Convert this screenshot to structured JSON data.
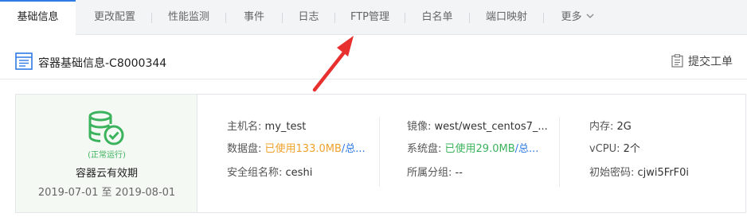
{
  "tabs": [
    {
      "label": "基础信息",
      "active": true
    },
    {
      "label": "更改配置"
    },
    {
      "label": "性能监测"
    },
    {
      "label": "事件"
    },
    {
      "label": "日志"
    },
    {
      "label": "FTP管理"
    },
    {
      "label": "白名单"
    },
    {
      "label": "端口映射"
    },
    {
      "label": "更多"
    }
  ],
  "header": {
    "title": "容器基础信息-C8000344",
    "ticket_label": "提交工单"
  },
  "status": {
    "running_text": "(正常运行)",
    "label": "容器云有效期",
    "dates": "2019-07-01 至 2019-08-01"
  },
  "info": {
    "hostname_key": "主机名:",
    "hostname_val": "my_test",
    "datadisk_key": "数据盘:",
    "datadisk_used": "已使用133.0MB",
    "datadisk_slash": "/",
    "datadisk_total": "总...",
    "secgroup_key": "安全组名称:",
    "secgroup_val": "ceshi",
    "image_key": "镜像:",
    "image_val": "west/west_centos7_...",
    "sysdisk_key": "系统盘:",
    "sysdisk_used": "已使用29.0MB",
    "sysdisk_slash": "/",
    "sysdisk_total": "总...",
    "group_key": "所属分组:",
    "group_val": "--",
    "mem_key": "内存:",
    "mem_val": "2G",
    "vcpu_key": "vCPU:",
    "vcpu_val": "2个",
    "pwd_key": "初始密码:",
    "pwd_val": "cjwi5FrF0i"
  },
  "colors": {
    "accent": "#2f7ae5",
    "success": "#3bb35c",
    "warning": "#f0a12b",
    "arrow": "#e8312f"
  },
  "icons": [
    "document-icon",
    "database-check-icon",
    "clipboard-icon",
    "chevron-down-icon"
  ]
}
